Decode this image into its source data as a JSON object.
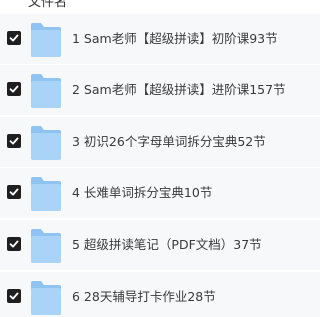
{
  "header": {
    "column_label": "文件名",
    "sort_icon": "sort-desc-icon"
  },
  "files": [
    {
      "name": "1 Sam老师【超级拼读】初阶课93节",
      "checked": true,
      "icon": "folder-icon"
    },
    {
      "name": "2 Sam老师【超级拼读】进阶课157节",
      "checked": true,
      "icon": "folder-icon"
    },
    {
      "name": "3 初识26个字母单词拆分宝典52节",
      "checked": true,
      "icon": "folder-icon"
    },
    {
      "name": "4 长难单词拆分宝典10节",
      "checked": true,
      "icon": "folder-icon"
    },
    {
      "name": "5 超级拼读笔记（PDF文档）37节",
      "checked": true,
      "icon": "folder-icon"
    },
    {
      "name": "6 28天辅导打卡作业28节",
      "checked": true,
      "icon": "folder-icon"
    }
  ],
  "colors": {
    "row_bg": "#f7f8fa",
    "checkbox": "#1f1f1f",
    "folder_back": "#8fc3f2",
    "folder_front": "#a9d3f7",
    "text": "#3a3a3a"
  }
}
